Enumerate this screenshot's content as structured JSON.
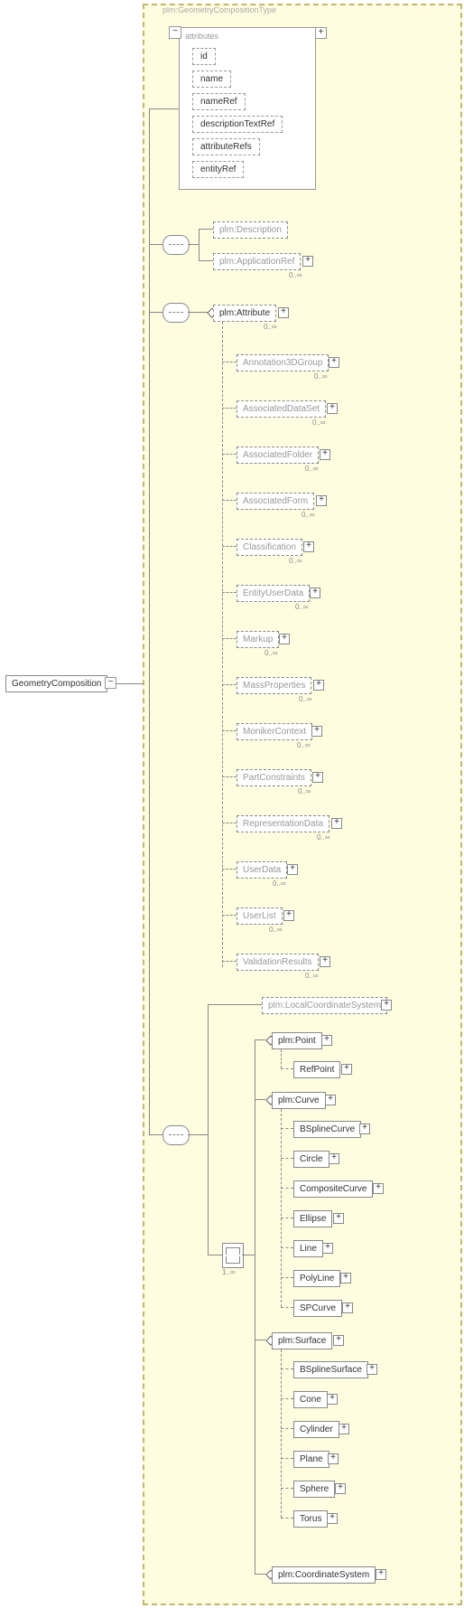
{
  "typeTitle": "plm:GeometryCompositionType",
  "root": "GeometryComposition",
  "attrHead": "attributes",
  "attrs": [
    "id",
    "name",
    "nameRef",
    "descriptionTextRef",
    "attributeRefs",
    "entityRef"
  ],
  "desc": "plm:Description",
  "appref": "plm:ApplicationRef",
  "attrNode": "plm:Attribute",
  "children": [
    "Annotation3DGroup",
    "AssociatedDataSet",
    "AssociatedFolder",
    "AssociatedForm",
    "Classification",
    "EntityUserData",
    "Markup",
    "MassProperties",
    "MonikerContext",
    "PartConstraints",
    "RepresentationData",
    "UserData",
    "UserList",
    "ValidationResults"
  ],
  "lcs": "plm:LocalCoordinateSystem",
  "point": "plm:Point",
  "refpoint": "RefPoint",
  "curve": "plm:Curve",
  "curves": [
    "BSplineCurve",
    "Circle",
    "CompositeCurve",
    "Ellipse",
    "Line",
    "PolyLine",
    "SPCurve"
  ],
  "surface": "plm:Surface",
  "surfaces": [
    "BSplineSurface",
    "Cone",
    "Cylinder",
    "Plane",
    "Sphere",
    "Torus"
  ],
  "coord": "plm:CoordinateSystem",
  "c0i": "0..∞",
  "c1i": "1..∞"
}
